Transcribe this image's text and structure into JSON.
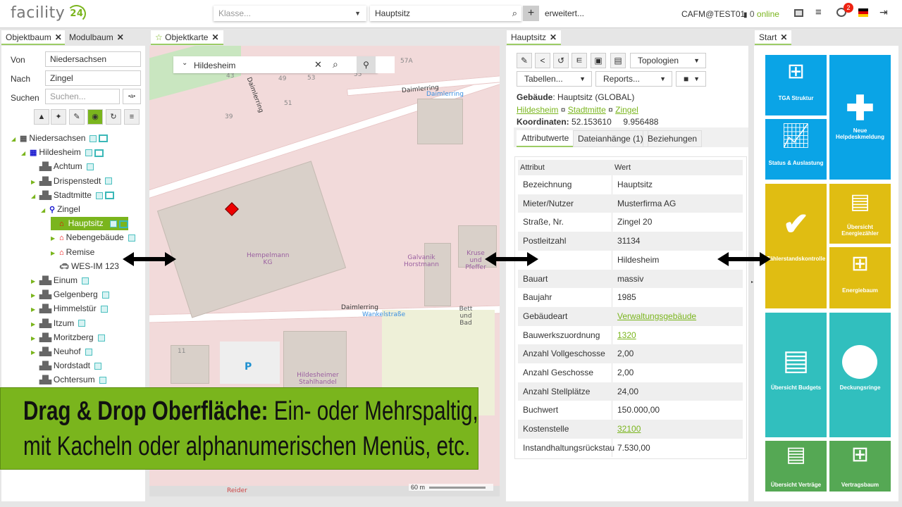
{
  "header": {
    "logo": "facility",
    "logo_num": "24",
    "class_placeholder": "Klasse...",
    "search_value": "Hauptsitz",
    "add": "+",
    "advanced": "erweitert...",
    "user": "CAFM@TEST01",
    "online_count": "0",
    "online_label": "online",
    "notifications": "2"
  },
  "tabs": {
    "left": [
      {
        "label": "Objektbaum"
      },
      {
        "label": "Modulbaum"
      }
    ],
    "map": "Objektkarte",
    "detail": "Hauptsitz",
    "start": "Start"
  },
  "tree_panel": {
    "von_label": "Von",
    "von_value": "Niedersachsen",
    "nach_label": "Nach",
    "nach_value": "Zingel",
    "suchen_label": "Suchen",
    "suchen_placeholder": "Suchen...",
    "regex_btn": "•a•",
    "items": [
      {
        "label": "Niedersachsen"
      },
      {
        "label": "Hildesheim"
      },
      {
        "label": "Achtum"
      },
      {
        "label": "Drispenstedt"
      },
      {
        "label": "Stadtmitte"
      },
      {
        "label": "Zingel"
      },
      {
        "label": "Hauptsitz"
      },
      {
        "label": "Nebengebäude"
      },
      {
        "label": "Remise"
      },
      {
        "label": "WES-IM 123"
      },
      {
        "label": "Einum"
      },
      {
        "label": "Gelgenberg"
      },
      {
        "label": "Himmelstür"
      },
      {
        "label": "Itzum"
      },
      {
        "label": "Moritzberg"
      },
      {
        "label": "Neuhof"
      },
      {
        "label": "Nordstadt"
      },
      {
        "label": "Ochtersum"
      }
    ]
  },
  "map": {
    "search_value": "Hildesheim",
    "scale": "60 m",
    "labels": {
      "street1": "Daimlerring",
      "street2": "Daimlerring",
      "street3": "Daimlerring",
      "stop1": "Daimlerring",
      "stop2": "Wankelstraße",
      "b1": "Hempelmann KG",
      "b2": "Galvanik Horstmann",
      "b3": "Kruse und Pfeffer",
      "b4": "Hildesheimer Stahlhandel",
      "b5": "Bett und Bad",
      "n43": "43",
      "n49": "49",
      "n53": "53",
      "n55": "55",
      "n57": "57A",
      "n51": "51",
      "n39": "39",
      "n11": "11",
      "p": "P",
      "reider": "Reider"
    }
  },
  "detail": {
    "topologien": "Topologien",
    "tabellen": "Tabellen...",
    "reports": "Reports...",
    "gebaeude_label": "Gebäude",
    "gebaeude_value": ": Hauptsitz (GLOBAL)",
    "crumbs": [
      "Hildesheim",
      "Stadtmitte",
      "Zingel"
    ],
    "crumb_sep": "¤",
    "koord_label": "Koordinaten:",
    "lat": "52.153610",
    "lon": "9.956488",
    "tabs": [
      "Attributwerte",
      "Dateianhänge (1)",
      "Beziehungen"
    ],
    "col_attr": "Attribut",
    "col_wert": "Wert",
    "rows": [
      {
        "a": "Bezeichnung",
        "w": "Hauptsitz"
      },
      {
        "a": "Mieter/Nutzer",
        "w": "Musterfirma AG"
      },
      {
        "a": "Straße, Nr.",
        "w": "Zingel 20"
      },
      {
        "a": "Postleitzahl",
        "w": "31134"
      },
      {
        "a": "",
        "w": "Hildesheim"
      },
      {
        "a": "Bauart",
        "w": "massiv"
      },
      {
        "a": "Baujahr",
        "w": "1985"
      },
      {
        "a": "Gebäudeart",
        "w": "Verwaltungsgebäude",
        "link": true
      },
      {
        "a": "Bauwerkszuordnung",
        "w": "1320",
        "link": true
      },
      {
        "a": "Anzahl Vollgeschosse",
        "w": "2,00"
      },
      {
        "a": "Anzahl Geschosse",
        "w": "2,00"
      },
      {
        "a": "Anzahl Stellplätze",
        "w": "24,00"
      },
      {
        "a": "Buchwert",
        "w": "150.000,00"
      },
      {
        "a": "Kostenstelle",
        "w": "32100",
        "link": true
      },
      {
        "a": "Instandhaltungsrückstau",
        "w": "7.530,00"
      }
    ]
  },
  "tiles": {
    "tga": "TGA Struktur",
    "status": "Status & Auslastung",
    "neue": "Neue Helpdeskmeldung",
    "zaehler": "Zählerstandskontrolle",
    "energiezaehler": "Übersicht Energiezähler",
    "energiebaum": "Energiebaum",
    "budgets": "Übersicht Budgets",
    "deckung": "Deckungsringe",
    "vertraege": "Übersicht Verträge",
    "vertragsbaum": "Vertragsbaum"
  },
  "banner": {
    "bold": "Drag & Drop Oberfläche:",
    "line1": " Ein- oder Mehrspaltig,",
    "line2": "mit Kacheln oder alphanumerischen Menüs, etc."
  },
  "colors": {
    "accent": "#7ab51d",
    "blue": "#0aa4e6",
    "yellow": "#e0bd12",
    "teal": "#31bfbe",
    "green": "#55a854"
  }
}
